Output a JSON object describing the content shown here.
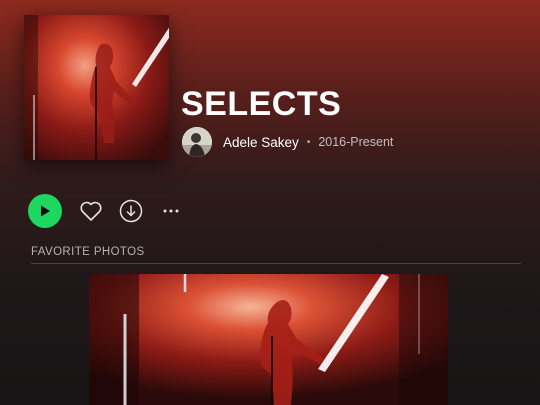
{
  "album": {
    "title": "SELECTS",
    "artist": "Adele Sakey",
    "separator": "•",
    "years": "2016-Present"
  },
  "section": {
    "label": "FAVORITE PHOTOS"
  },
  "colors": {
    "accent": "#1ed760",
    "header_red": "#8e2a1f",
    "background": "#171516"
  },
  "icons": {
    "play": "play-icon",
    "like": "heart-icon",
    "download": "download-icon",
    "more": "more-icon"
  }
}
